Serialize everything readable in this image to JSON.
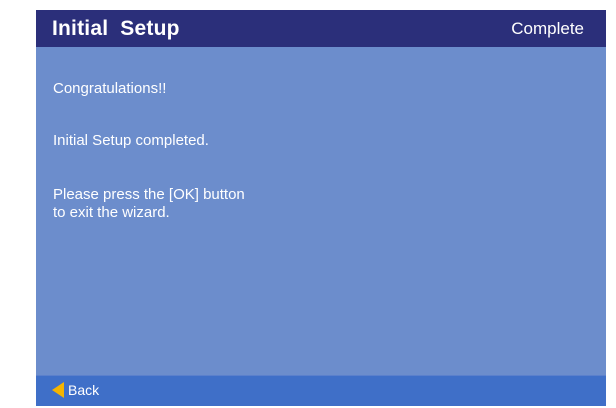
{
  "header": {
    "title": "Initial  Setup",
    "status": "Complete"
  },
  "main": {
    "line1": "Congratulations!!",
    "line2": "Initial Setup completed.",
    "line3": "Please press the [OK] button",
    "line4": "to exit the wizard."
  },
  "footer": {
    "back_label": "Back",
    "back_icon": "back-arrow-icon"
  },
  "colors": {
    "background": "#6c8dcc",
    "header": "#2b2f7a",
    "footer": "#3f6fc8",
    "back_icon": "#f5b400"
  }
}
